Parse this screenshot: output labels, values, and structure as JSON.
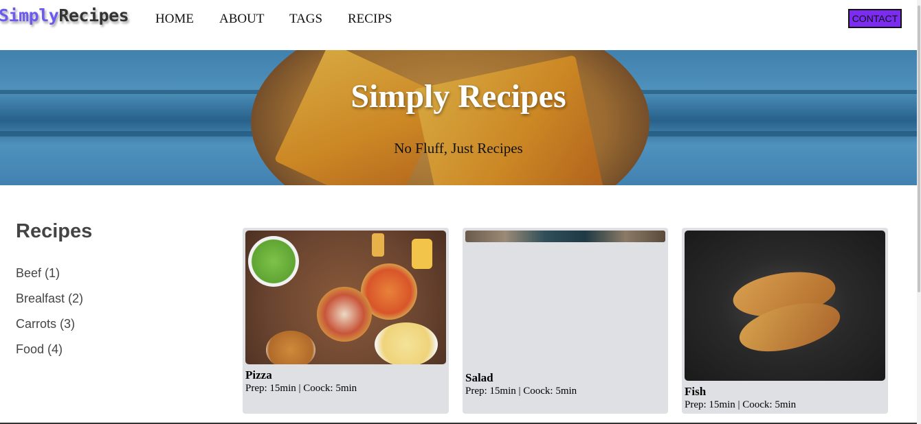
{
  "logo": {
    "part1": "Simply",
    "part2": "Recipes"
  },
  "nav": {
    "items": [
      "HOME",
      "ABOUT",
      "TAGS",
      "RECIPS"
    ],
    "contact": "CONTACT"
  },
  "hero": {
    "title": "Simply Recipes",
    "subtitle": "No Fluff, Just Recipes"
  },
  "sidebar": {
    "title": "Recipes",
    "tags": [
      "Beef (1)",
      "Brealfast (2)",
      "Carrots (3)",
      "Food (4)"
    ]
  },
  "recipes": [
    {
      "name": "Pizza",
      "meta": "Prep: 15min | Coock: 5min"
    },
    {
      "name": "Salad",
      "meta": "Prep: 15min | Coock: 5min"
    },
    {
      "name": "Fish",
      "meta": "Prep: 15min | Coock: 5min"
    }
  ],
  "colors": {
    "accent": "#7b2cf0",
    "logo": "#6a5af0",
    "card_bg": "#dfe0e3"
  }
}
